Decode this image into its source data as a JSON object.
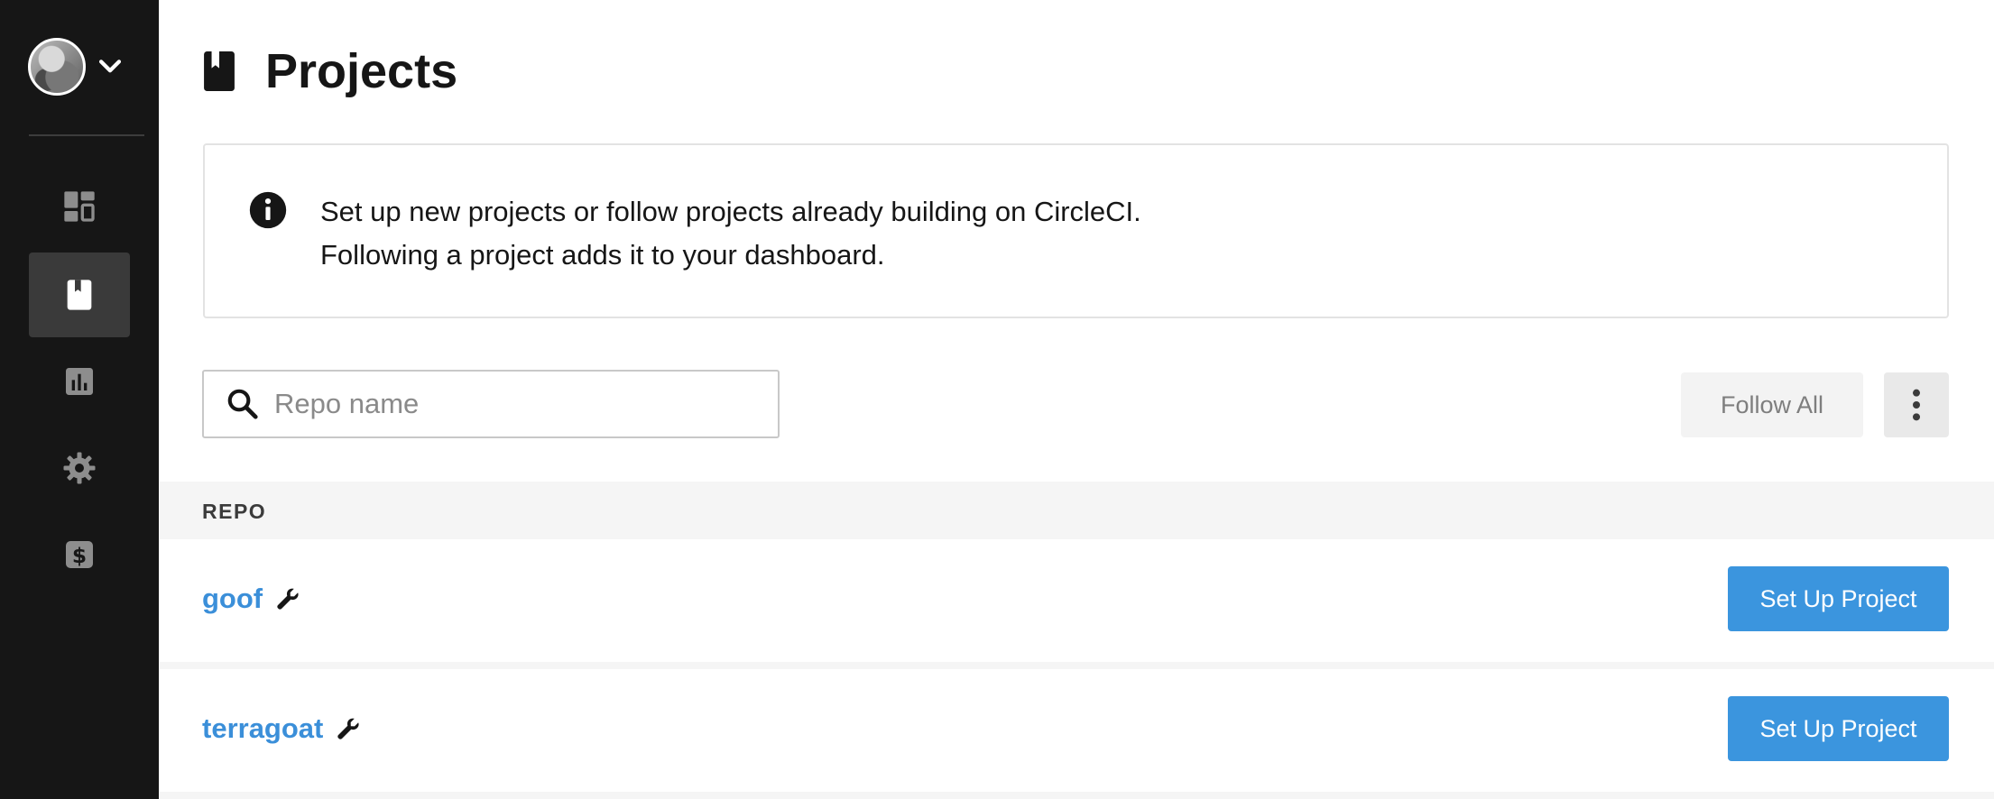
{
  "sidebar": {
    "org_avatar_icon": "user-avatar",
    "chevron_icon": "chevron-down-icon",
    "items": [
      {
        "key": "dashboard",
        "icon": "dashboard-icon",
        "active": false
      },
      {
        "key": "projects",
        "icon": "book-icon",
        "active": true
      },
      {
        "key": "insights",
        "icon": "bar-chart-icon",
        "active": false
      },
      {
        "key": "settings",
        "icon": "gear-icon",
        "active": false
      },
      {
        "key": "plan",
        "icon": "dollar-icon",
        "active": false
      }
    ]
  },
  "header": {
    "title": "Projects",
    "icon": "book-icon"
  },
  "info": {
    "icon": "info-icon",
    "line1": "Set up new projects or follow projects already building on CircleCI.",
    "line2": "Following a project adds it to your dashboard."
  },
  "search": {
    "placeholder": "Repo name",
    "value": ""
  },
  "actions": {
    "follow_all_label": "Follow All",
    "more_icon": "more-vertical-icon"
  },
  "table": {
    "column_header": "REPO",
    "rows": [
      {
        "name": "goof",
        "icon": "wrench-icon",
        "button_label": "Set Up Project"
      },
      {
        "name": "terragoat",
        "icon": "wrench-icon",
        "button_label": "Set Up Project"
      }
    ]
  },
  "colors": {
    "sidebar_bg": "#161616",
    "link_blue": "#3b8fd9",
    "primary_button": "#3b95de",
    "table_header_bg": "#f5f5f5"
  }
}
